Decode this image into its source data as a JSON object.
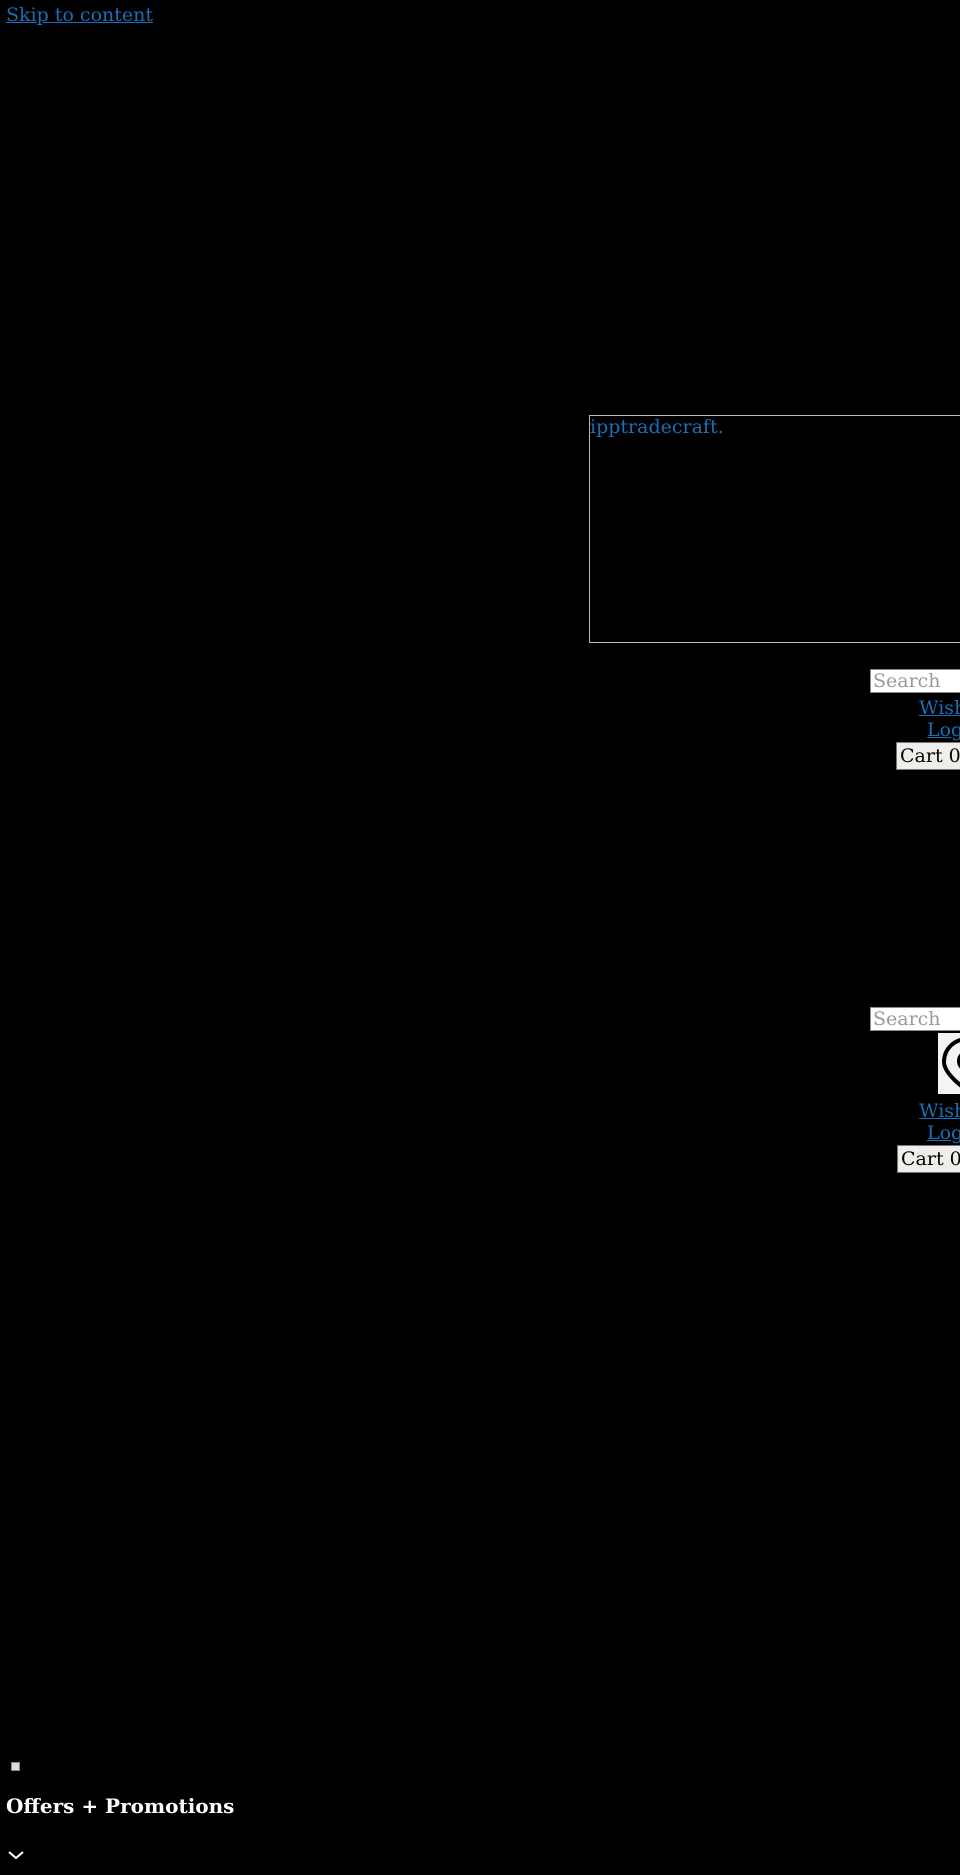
{
  "skip_link": "Skip to content",
  "logo_text": "ipptradecraft.",
  "header_primary": {
    "search_placeholder": "Search",
    "wishlist_label": "Wishlist",
    "login_label": "Login",
    "cart_label": "Cart 0"
  },
  "header_secondary": {
    "search_placeholder": "Search",
    "location_icon": "map-pin-icon",
    "wishlist_label": "Wishlist",
    "login_label": "Login",
    "cart_label": "Cart 0"
  },
  "promo": {
    "title": "Offers + Promotions",
    "toggle_icon": "chevron-down-icon"
  }
}
